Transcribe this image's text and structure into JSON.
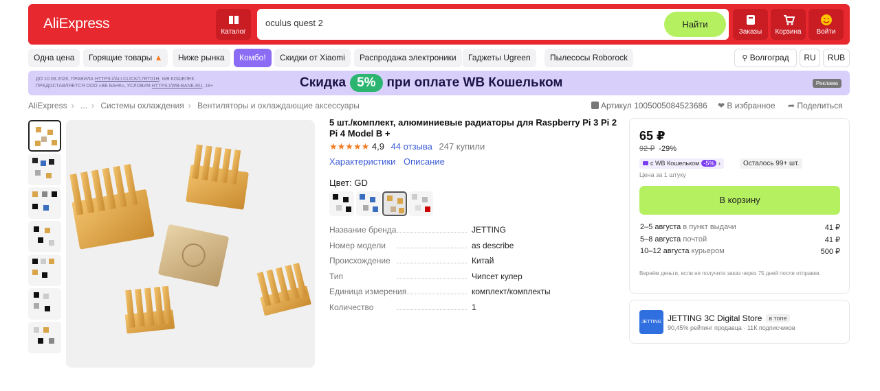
{
  "header": {
    "logo": "AliExpress",
    "catalog_label": "Каталог",
    "search_value": "oculus quest 2",
    "search_button": "Найти",
    "orders_label": "Заказы",
    "cart_label": "Корзина",
    "login_label": "Войти"
  },
  "categories": [
    "Одна цена",
    "Горящие товары",
    "Ниже рынка",
    "Комбо!",
    "Скидки от Xiaomi",
    "Распродажа электроники",
    "Гаджеты Ugreen",
    "Пылесосы Roborock"
  ],
  "region": {
    "city": "Волгоград",
    "lang": "RU",
    "currency": "RUB"
  },
  "banner": {
    "legal_line1": "ДО 10.08.2026, ПРАВИЛА",
    "legal_link1": "HTTPS://ALI.CLICK/17RT01H",
    "legal_line1b": ", WB КОШЕЛЕК",
    "legal_line2": "ПРЕДОСТАВЛЯЕТСЯ ООО «ВБ БАНК», УСЛОВИЯ",
    "legal_link2": "HTTPS://WB-BANK.RU",
    "legal_line2b": ", 18+",
    "promo_before": "Скидка",
    "promo_pct": "5%",
    "promo_after": "при оплате WB Кошельком",
    "ad_label": "Реклама"
  },
  "breadcrumbs": [
    "AliExpress",
    "...",
    "Системы охлаждения",
    "Вентиляторы и охлаждающие аксессуары"
  ],
  "meta": {
    "article": "Артикул 1005005084523686",
    "favorite": "В избранное",
    "share": "Поделиться"
  },
  "product": {
    "title": "5 шт./комплект, алюминиевые радиаторы для Raspberry Pi 3 Pi 2 Pi 4 Model B +",
    "stars": "★★★★★",
    "rating": "4,9",
    "reviews": "44 отзыва",
    "sold": "247 купили",
    "link_specs": "Характеристики",
    "link_desc": "Описание",
    "color_label": "Цвет: GD",
    "specs": [
      {
        "k": "Название бренда",
        "v": "JETTING"
      },
      {
        "k": "Номер модели",
        "v": "as describe"
      },
      {
        "k": "Происхождение",
        "v": "Китай"
      },
      {
        "k": "Тип",
        "v": "Чипсет кулер"
      },
      {
        "k": "Единица измерения",
        "v": "комплект/комплекты"
      },
      {
        "k": "Количество",
        "v": "1"
      }
    ]
  },
  "offer": {
    "price": "65 ₽",
    "old_price": "92 ₽",
    "discount": "-29%",
    "wb_label": "с WB Кошельком",
    "wb_discount": "-5%",
    "stock": "Осталось 99+ шт.",
    "unit_price": "Цена за 1 штуку",
    "cart_button": "В корзину",
    "delivery": [
      {
        "date": "2–5 августа",
        "type": "в пункт выдачи",
        "price": "41 ₽"
      },
      {
        "date": "5–8 августа",
        "type": "почтой",
        "price": "41 ₽"
      },
      {
        "date": "10–12 августа",
        "type": "курьером",
        "price": "500 ₽"
      }
    ],
    "refund": "Вернём деньги, если не получите заказ через 75 дней после отправки."
  },
  "store": {
    "logo_text": "JETTING",
    "name": "JETTING 3C Digital Store",
    "badge": "в топе",
    "info": "90,45% рейтинг продавца · 11К подписчиков"
  },
  "colors": {
    "accent": "#e8282f",
    "cta": "#b5f060",
    "combo": "#8b6cf5",
    "link": "#3b5bd6"
  }
}
